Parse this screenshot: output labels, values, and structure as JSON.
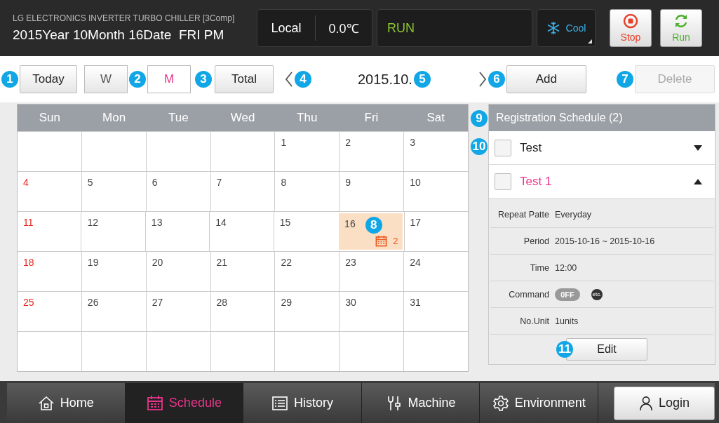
{
  "header": {
    "title": "LG ELECTRONICS INVERTER TURBO CHILLER [3Comp]",
    "datetime": "2015Year 10Month 16Date  FRI PM",
    "control_mode": "Local",
    "temperature": "0.0℃",
    "status": "RUN",
    "operation_mode": "Cool",
    "buttons": [
      {
        "label": "Stop",
        "kind": "stop"
      },
      {
        "label": "Run",
        "kind": "run"
      }
    ]
  },
  "toolbar": {
    "today": {
      "label": "Today",
      "callout": "1"
    },
    "view_tabs": [
      {
        "label": "W",
        "selected": false
      },
      {
        "label": "M",
        "selected": true,
        "callout": "2"
      }
    ],
    "total": {
      "label": "Total",
      "callout": "3"
    },
    "prev_callout": "4",
    "month": "2015.10.",
    "month_callout": "5",
    "add": {
      "label": "Add",
      "callout": "6"
    },
    "delete": {
      "label": "Delete",
      "disabled": true,
      "callout": "7"
    }
  },
  "calendar": {
    "weekdays": [
      "Sun",
      "Mon",
      "Tue",
      "Wed",
      "Thu",
      "Fri",
      "Sat"
    ],
    "weeks": [
      [
        {
          "day": "1"
        },
        {
          "day": "2"
        },
        {
          "day": "3"
        }
      ],
      [
        {
          "day": "4"
        },
        {
          "day": "5"
        },
        {
          "day": "6"
        },
        {
          "day": "7"
        },
        {
          "day": "8"
        },
        {
          "day": "9"
        },
        {
          "day": "10"
        }
      ],
      [
        {
          "day": "11"
        },
        {
          "day": "12"
        },
        {
          "day": "13"
        },
        {
          "day": "14"
        },
        {
          "day": "15"
        },
        {
          "day": "16",
          "selected": true,
          "events": "2",
          "callout": "8"
        },
        {
          "day": "17"
        }
      ],
      [
        {
          "day": "18"
        },
        {
          "day": "19"
        },
        {
          "day": "20"
        },
        {
          "day": "21"
        },
        {
          "day": "22"
        },
        {
          "day": "23"
        },
        {
          "day": "24"
        }
      ],
      [
        {
          "day": "25"
        },
        {
          "day": "26"
        },
        {
          "day": "27"
        },
        {
          "day": "28"
        },
        {
          "day": "29"
        },
        {
          "day": "30"
        },
        {
          "day": "31"
        }
      ]
    ]
  },
  "schedule_panel": {
    "title": "Registration Schedule (2)",
    "callout": "9",
    "items": [
      {
        "label": "Test",
        "checked": false,
        "selected": false,
        "expanded": false,
        "callout": "10"
      },
      {
        "label": "Test 1",
        "checked": false,
        "selected": true,
        "expanded": true
      }
    ],
    "details": [
      {
        "kind": "text",
        "label": "Repeat Patte",
        "value": "Everyday"
      },
      {
        "kind": "text",
        "label": "Period",
        "value": "2015-10-16 ~ 2015-10-16"
      },
      {
        "kind": "text",
        "label": "Time",
        "value": "12:00"
      },
      {
        "kind": "command",
        "label": "Command",
        "toggle": "0FF",
        "on": false,
        "badge": "etc."
      },
      {
        "kind": "text",
        "label": "No.Unit",
        "value": "1units"
      }
    ],
    "edit": {
      "label": "Edit",
      "callout": "11"
    }
  },
  "nav": {
    "items": [
      {
        "label": "Home",
        "kind": "home",
        "selected": false
      },
      {
        "label": "Schedule",
        "kind": "calendar",
        "selected": true
      },
      {
        "label": "History",
        "kind": "list",
        "selected": false
      },
      {
        "label": "Machine",
        "kind": "tools",
        "selected": false
      },
      {
        "label": "Environment",
        "kind": "gear",
        "selected": false
      }
    ],
    "login": "Login"
  }
}
